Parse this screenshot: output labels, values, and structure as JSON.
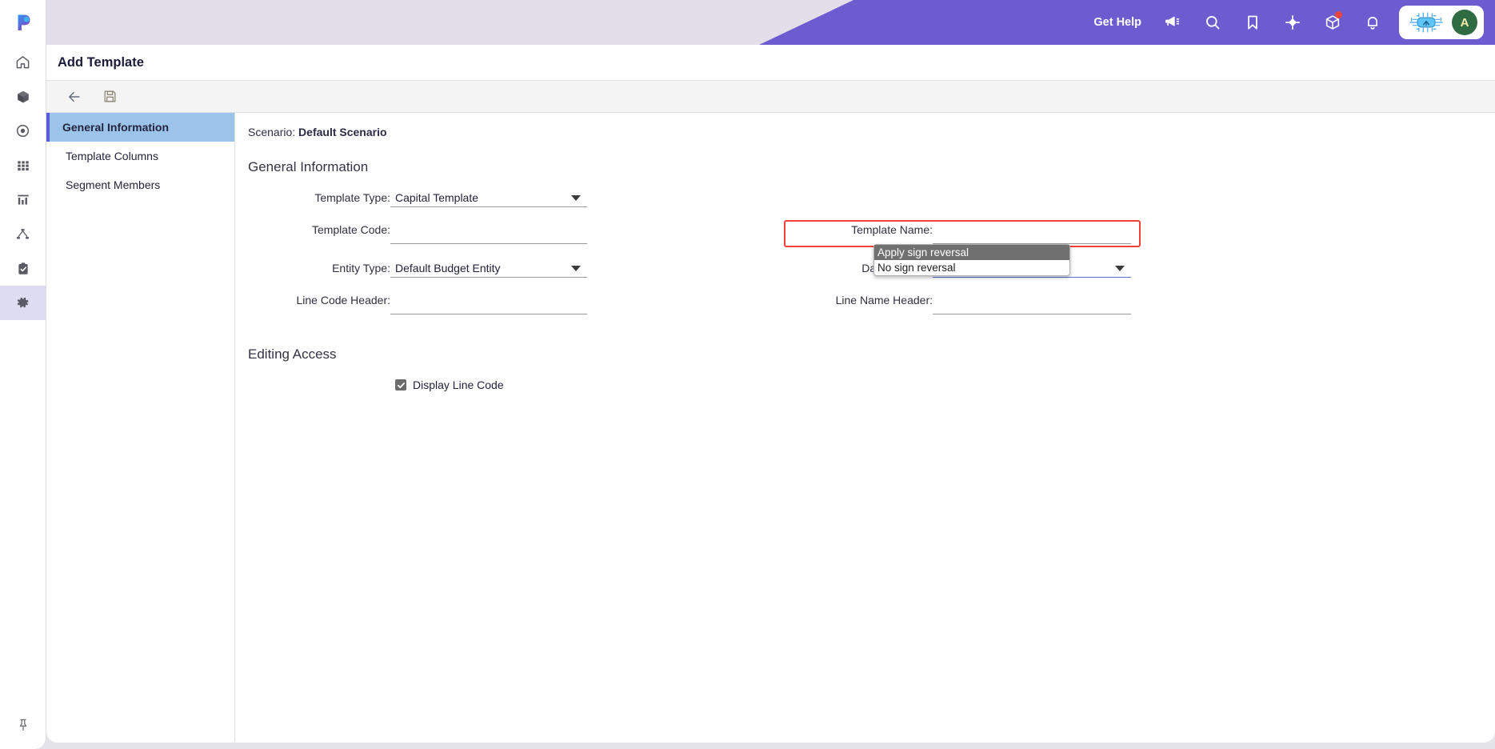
{
  "header": {
    "get_help": "Get Help",
    "icons": [
      {
        "name": "announcement-icon"
      },
      {
        "name": "search-icon"
      },
      {
        "name": "bookmark-icon"
      },
      {
        "name": "target-icon"
      },
      {
        "name": "package-icon",
        "badge": true
      },
      {
        "name": "bell-icon"
      }
    ],
    "ai_chip_icon": "ai-chip-icon",
    "avatar_initial": "A",
    "brand_color": "#6d5bd0",
    "avatar_color": "#2f6b43"
  },
  "rail": {
    "logo": "p-logo-icon",
    "items": [
      {
        "name": "home-icon",
        "active": false
      },
      {
        "name": "box-icon",
        "active": false
      },
      {
        "name": "target-circle-icon",
        "active": false
      },
      {
        "name": "grid-icon",
        "active": false
      },
      {
        "name": "chart-icon",
        "active": false
      },
      {
        "name": "hierarchy-icon",
        "active": false
      },
      {
        "name": "clipboard-check-icon",
        "active": false
      },
      {
        "name": "gear-icon",
        "active": true
      }
    ],
    "pin_icon": "pin-icon"
  },
  "page": {
    "title": "Add Template",
    "toolbar": [
      {
        "name": "back-button",
        "icon": "arrow-left-icon"
      },
      {
        "name": "save-button",
        "icon": "save-disk-icon"
      }
    ]
  },
  "tabs": [
    {
      "label": "General Information",
      "active": true
    },
    {
      "label": "Template Columns",
      "active": false
    },
    {
      "label": "Segment Members",
      "active": false
    }
  ],
  "form": {
    "scenario_label": "Scenario:",
    "scenario_value": "Default Scenario",
    "section_general": "General Information",
    "section_editing_access": "Editing Access",
    "left_fields": [
      {
        "label": "Template Type:",
        "value": "Capital Template",
        "type": "select"
      },
      {
        "label": "Template Code:",
        "value": "",
        "type": "text"
      },
      {
        "label": "Entity Type:",
        "value": "Default Budget Entity",
        "type": "select"
      },
      {
        "label": "Line Code Header:",
        "value": "",
        "type": "text"
      }
    ],
    "right_fields": [
      {
        "label": "Template Name:",
        "value": "",
        "type": "text"
      },
      {
        "label": "Data Transfer:",
        "value": "Apply sign reversal",
        "type": "select",
        "highlighted": true,
        "open": true
      },
      {
        "label": "Line Name Header:",
        "value": "",
        "type": "text"
      }
    ],
    "data_transfer_options": [
      {
        "label": "Apply sign reversal",
        "selected": true
      },
      {
        "label": "No sign reversal",
        "selected": false
      }
    ],
    "checkbox": {
      "label": "Display Line Code",
      "checked": true
    },
    "highlight_color": "#ef4136"
  }
}
